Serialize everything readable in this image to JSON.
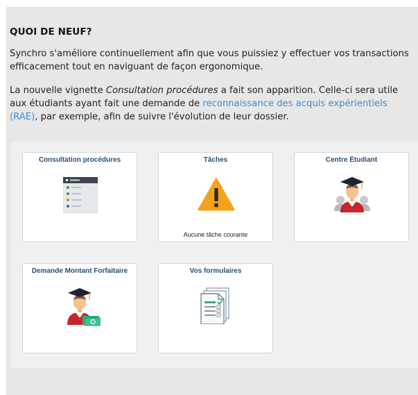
{
  "news": {
    "heading": "QUOI DE NEUF?",
    "p1_line1": "Synchro s'améliore continuellement afin que vous puissiez y effectuer vos transactions",
    "p1_line2": "efficacement tout en naviguant de façon ergonomique.",
    "p2_line1_a": "La nouvelle vignette ",
    "p2_line1_em": "Consultation procédures",
    "p2_line1_b": " a fait son apparition. Celle-ci sera utile",
    "p2_line2_a": "aux étudiants ayant fait une demande de ",
    "p2_link_part1": "reconnaissance des acquis expérientiels",
    "p2_link_part2": "(RAE)",
    "p2_line3_b": ", par exemple, afin de suivre l'évolution de leur dossier."
  },
  "tiles": [
    {
      "title": "Consultation procédures",
      "icon": "procedures-list-icon",
      "footer": ""
    },
    {
      "title": "Tâches",
      "icon": "warning-icon",
      "footer": "Aucune tâche courante"
    },
    {
      "title": "Centre Étudiant",
      "icon": "student-graduate-icon",
      "footer": ""
    },
    {
      "title": "Demande Montant Forfaitaire",
      "icon": "student-money-icon",
      "footer": ""
    },
    {
      "title": "Vos formulaires",
      "icon": "forms-checklist-icon",
      "footer": ""
    }
  ],
  "colors": {
    "link": "#3a8fd8",
    "tile_title": "#2a4e79",
    "warning": "#f4a21a",
    "panel_bg": "#e7e7e7"
  }
}
